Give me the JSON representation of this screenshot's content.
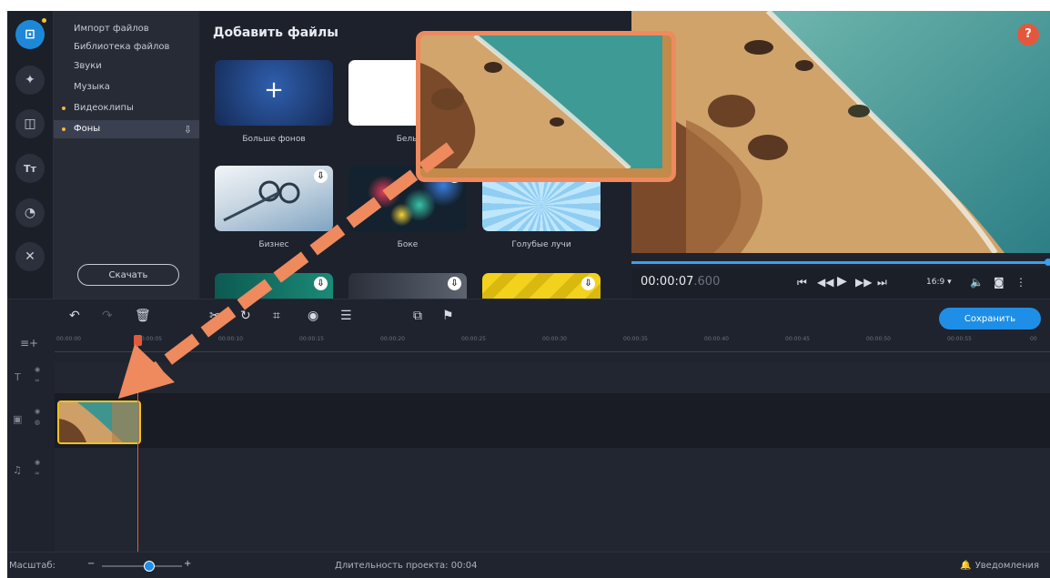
{
  "sidebar": {
    "items": [
      {
        "icon": "import-icon"
      },
      {
        "icon": "effects-icon"
      },
      {
        "icon": "transitions-icon"
      },
      {
        "icon": "titles-icon"
      },
      {
        "icon": "stickers-icon"
      },
      {
        "icon": "tools-icon"
      }
    ]
  },
  "categories": {
    "items": [
      "Импорт файлов",
      "Библиотека файлов",
      "Звуки",
      "Музыка",
      "Видеоклипы",
      "Фоны"
    ],
    "download_button": "Скачать"
  },
  "content": {
    "title": "Добавить файлы",
    "tiles": [
      {
        "label": "Больше фонов"
      },
      {
        "label": "Белы"
      },
      {
        "label": ""
      },
      {
        "label": "Бизнес"
      },
      {
        "label": "Боке"
      },
      {
        "label": "Голубые лучи"
      }
    ]
  },
  "player": {
    "time": "00:00:07",
    "time_ms": ".600",
    "aspect": "16:9",
    "progress": 1.0
  },
  "timeline": {
    "save_button": "Сохранить",
    "ticks": [
      "00:00:00",
      "00:00:05",
      "00:00:10",
      "00:00:15",
      "00:00:20",
      "00:00:25",
      "00:00:30",
      "00:00:35",
      "00:00:40",
      "00:00:45",
      "00:00:50",
      "00:00:55",
      "00"
    ]
  },
  "status": {
    "zoom_label": "Масштаб:",
    "duration": "Длительность проекта: 00:04",
    "notifications": "Уведомления"
  },
  "colors": {
    "accent": "#1f8ee6",
    "callout": "#ee8a5e",
    "clip_border": "#f0c21e",
    "help": "#e5573d"
  }
}
